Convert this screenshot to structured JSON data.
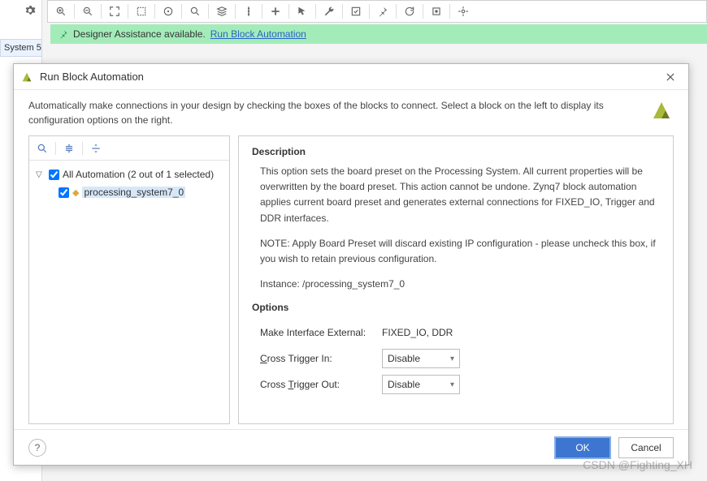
{
  "sidebar": {
    "tab_label": "System 5."
  },
  "banner": {
    "text": "Designer Assistance available.",
    "link": "Run Block Automation"
  },
  "dialog": {
    "title": "Run Block Automation",
    "header_text": "Automatically make connections in your design by checking the boxes of the blocks to connect. Select a block on the left to display its configuration options on the right.",
    "tree": {
      "root_label": "All Automation (2 out of 1 selected)",
      "item_label": "processing_system7_0"
    },
    "description_heading": "Description",
    "description_p1": "This option sets the board preset on the Processing System. All current properties will be overwritten by the board preset. This action cannot be undone. Zynq7 block automation applies current board preset and generates external connections for FIXED_IO, Trigger and DDR interfaces.",
    "description_p2": "NOTE: Apply Board Preset will discard existing IP configuration - please uncheck this box, if you wish to retain previous configuration.",
    "instance_label": "Instance: /processing_system7_0",
    "options_heading": "Options",
    "options": {
      "iface_label": "Make Interface External:",
      "iface_value": "FIXED_IO, DDR",
      "cti_prefix": "C",
      "cti_rest": "ross Trigger In:",
      "cti_value": "Disable",
      "cto_prefix": "Cross ",
      "cto_u": "T",
      "cto_rest": "rigger Out:",
      "cto_value": "Disable"
    },
    "ok_label": "OK",
    "cancel_label": "Cancel",
    "help_label": "?"
  },
  "watermark": "CSDN @Fighting_XH"
}
